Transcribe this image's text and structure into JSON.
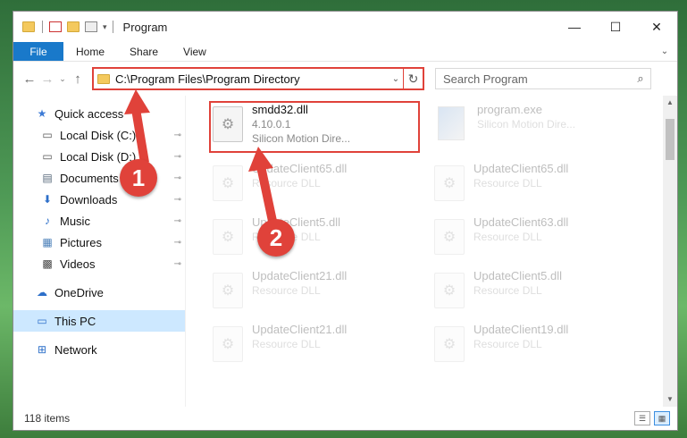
{
  "window": {
    "title": "Program",
    "minimize_glyph": "—",
    "maximize_glyph": "☐",
    "close_glyph": "✕"
  },
  "ribbon": {
    "tabs": [
      {
        "label": "File"
      },
      {
        "label": "Home"
      },
      {
        "label": "Share"
      },
      {
        "label": "View"
      }
    ],
    "expand_glyph": "⌄"
  },
  "nav": {
    "back_glyph": "←",
    "forward_glyph": "→",
    "recent_glyph": "⌄",
    "up_glyph": "↑",
    "address": "C:\\Program Files\\Program Directory",
    "refresh_glyph": "↻",
    "search_placeholder": "Search Program",
    "search_glyph": "⌕"
  },
  "sidebar": {
    "items": [
      {
        "label": "Quick access",
        "icon": "star-icon",
        "glyph": "★",
        "color": "#3d7bd6",
        "pinned": false
      },
      {
        "label": "Local Disk (C:)",
        "icon": "drive-icon",
        "glyph": "▭",
        "color": "#555555",
        "pinned": true
      },
      {
        "label": "Local Disk (D:)",
        "icon": "drive-icon",
        "glyph": "▭",
        "color": "#555555",
        "pinned": true
      },
      {
        "label": "Documents",
        "icon": "documents-icon",
        "glyph": "▤",
        "color": "#5a6b7d",
        "pinned": true
      },
      {
        "label": "Downloads",
        "icon": "download-icon",
        "glyph": "⬇",
        "color": "#2d6fc9",
        "pinned": true
      },
      {
        "label": "Music",
        "icon": "music-icon",
        "glyph": "♪",
        "color": "#2d6fc9",
        "pinned": true
      },
      {
        "label": "Pictures",
        "icon": "pictures-icon",
        "glyph": "▦",
        "color": "#4a7fb8",
        "pinned": true
      },
      {
        "label": "Videos",
        "icon": "videos-icon",
        "glyph": "▩",
        "color": "#444444",
        "pinned": true
      }
    ],
    "onedrive": {
      "label": "OneDrive",
      "glyph": "☁",
      "color": "#2d6fc9"
    },
    "thispc": {
      "label": "This PC",
      "glyph": "▭",
      "color": "#2d6fc9"
    },
    "network": {
      "label": "Network",
      "glyph": "⊞",
      "color": "#2d6fc9"
    },
    "pin_glyph": "⊸"
  },
  "files": {
    "highlighted": {
      "name": "smdd32.dll",
      "version": "4.10.0.1",
      "description": "Silicon Motion Dire..."
    },
    "exe": {
      "name": "program.exe",
      "description": "Silicon Motion Dire..."
    },
    "faded": [
      {
        "name": "UpdateClient65.dll",
        "sub": "Resource DLL"
      },
      {
        "name": "UpdateClient65.dll",
        "sub": "Resource DLL"
      },
      {
        "name": "UpdateClient5.dll",
        "sub": "Resource DLL"
      },
      {
        "name": "UpdateClient63.dll",
        "sub": "Resource DLL"
      },
      {
        "name": "UpdateClient21.dll",
        "sub": "Resource DLL"
      },
      {
        "name": "UpdateClient5.dll",
        "sub": "Resource DLL"
      },
      {
        "name": "UpdateClient21.dll",
        "sub": "Resource DLL"
      },
      {
        "name": "UpdateClient19.dll",
        "sub": "Resource DLL"
      }
    ],
    "gear_glyph": "⚙"
  },
  "status": {
    "count": "118 items"
  },
  "callouts": {
    "one": "1",
    "two": "2"
  },
  "colors": {
    "accent": "#1979ca",
    "highlight": "#e0423a",
    "selected": "#cde8ff"
  }
}
